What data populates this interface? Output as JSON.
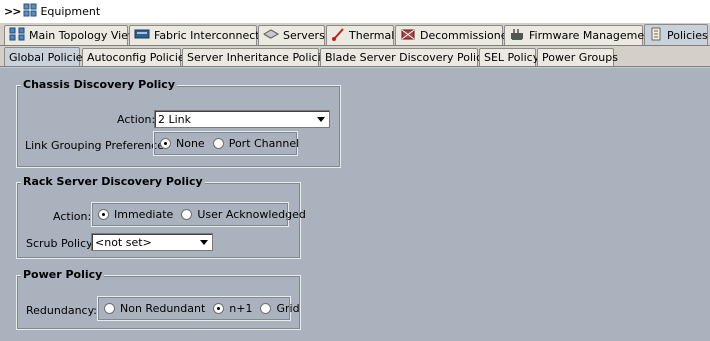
{
  "breadcrumb": {
    "arrows": ">>",
    "title": "Equipment"
  },
  "tabs": [
    {
      "label": "Main Topology View",
      "icon": "topology-icon"
    },
    {
      "label": "Fabric Interconnects",
      "icon": "fabric-interconnect-icon"
    },
    {
      "label": "Servers",
      "icon": "server-icon"
    },
    {
      "label": "Thermal",
      "icon": "thermometer-icon"
    },
    {
      "label": "Decommissioned",
      "icon": "decommission-icon"
    },
    {
      "label": "Firmware Management",
      "icon": "firmware-icon"
    },
    {
      "label": "Policies",
      "icon": "policy-icon",
      "active": true
    }
  ],
  "subtabs": [
    {
      "label": "Global Policies",
      "active": true
    },
    {
      "label": "Autoconfig Policies"
    },
    {
      "label": "Server Inheritance Policies"
    },
    {
      "label": "Blade Server Discovery Policies"
    },
    {
      "label": "SEL Policy"
    },
    {
      "label": "Power Groups"
    }
  ],
  "chassis": {
    "title": "Chassis Discovery Policy",
    "action_label": "Action:",
    "action_value": "2 Link",
    "grouping_label": "Link Grouping Preference:",
    "grouping_options": [
      "None",
      "Port Channel"
    ],
    "grouping_selected": "None"
  },
  "rack": {
    "title": "Rack Server Discovery Policy",
    "action_label": "Action:",
    "action_options": [
      "Immediate",
      "User Acknowledged"
    ],
    "action_selected": "Immediate",
    "scrub_label": "Scrub Policy:",
    "scrub_value": "<not set>"
  },
  "power": {
    "title": "Power Policy",
    "redundancy_label": "Redundancy:",
    "redundancy_options": [
      "Non Redundant",
      "n+1",
      "Grid"
    ],
    "redundancy_selected": "n+1"
  }
}
